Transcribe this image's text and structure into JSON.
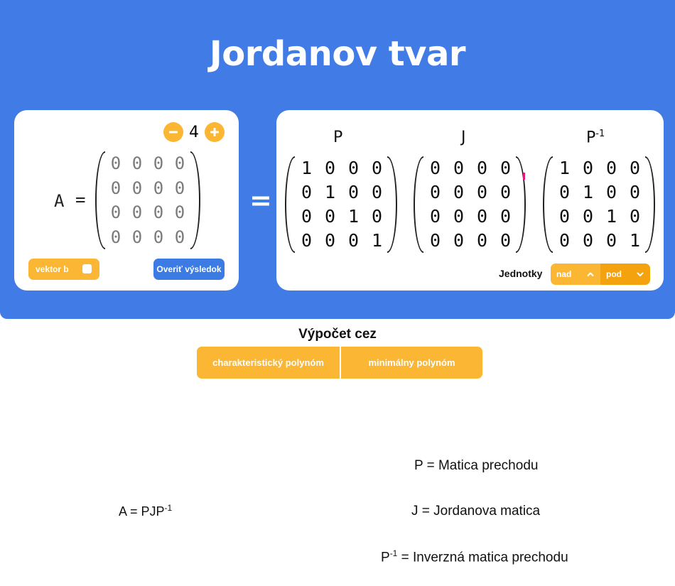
{
  "header": {
    "title": "Jordanov tvar"
  },
  "input_card": {
    "size_value": "4",
    "minus_icon": "minus-circle-icon",
    "plus_icon": "plus-circle-icon",
    "a_label": "A",
    "equals": "=",
    "matrix": [
      [
        "0",
        "0",
        "0",
        "0"
      ],
      [
        "0",
        "0",
        "0",
        "0"
      ],
      [
        "0",
        "0",
        "0",
        "0"
      ],
      [
        "0",
        "0",
        "0",
        "0"
      ]
    ],
    "vector_b_label": "vektor b",
    "verify_label": "Overiť výsledok"
  },
  "big_equals": "=",
  "result_card": {
    "p_label": "P",
    "j_label": "J",
    "pinv_label": "P",
    "pinv_sup": "-1",
    "p_matrix": [
      [
        "1",
        "0",
        "0",
        "0"
      ],
      [
        "0",
        "1",
        "0",
        "0"
      ],
      [
        "0",
        "0",
        "1",
        "0"
      ],
      [
        "0",
        "0",
        "0",
        "1"
      ]
    ],
    "j_matrix": [
      [
        "0",
        "0",
        "0",
        "0"
      ],
      [
        "0",
        "0",
        "0",
        "0"
      ],
      [
        "0",
        "0",
        "0",
        "0"
      ],
      [
        "0",
        "0",
        "0",
        "0"
      ]
    ],
    "pinv_matrix": [
      [
        "1",
        "0",
        "0",
        "0"
      ],
      [
        "0",
        "1",
        "0",
        "0"
      ],
      [
        "0",
        "0",
        "1",
        "0"
      ],
      [
        "0",
        "0",
        "0",
        "1"
      ]
    ],
    "units_label": "Jednotky",
    "units_nad": "nad",
    "units_pod": "pod"
  },
  "computation": {
    "title": "Výpočet cez",
    "option_1": "charakteristický polynóm",
    "option_2": "minimálny polynóm"
  },
  "formula": {
    "text": "A = PJP",
    "sup": "-1"
  },
  "legend": {
    "p": "P = Matica prechodu",
    "j": "J = Jordanova matica",
    "pinv_prefix": "P",
    "pinv_sup": "-1",
    "pinv_rest": " = Inverzná matica prechodu"
  },
  "colors": {
    "primary": "#407be6",
    "accent": "#fbb634",
    "accent_dark": "#f4a20d",
    "marker": "#e0197a"
  }
}
